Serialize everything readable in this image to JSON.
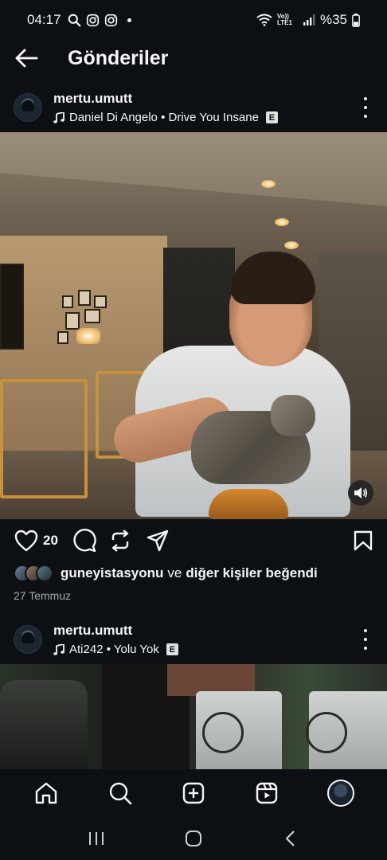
{
  "status_bar": {
    "time": "04:17",
    "network_label": "Vo)) LTE1",
    "battery_text": "%35"
  },
  "header": {
    "title": "Gönderiler"
  },
  "posts": [
    {
      "username": "mertu.umutt",
      "music": "Daniel Di Angelo • Drive You Insane",
      "explicit_badge": "E",
      "like_count": "20",
      "liked_by_user": "guneyistasyonu",
      "liked_by_connector": "ve",
      "liked_by_others": "diğer kişiler beğendi",
      "date": "27 Temmuz"
    },
    {
      "username": "mertu.umutt",
      "music": "Ati242 • Yolu Yok",
      "explicit_badge": "E"
    }
  ],
  "bottom_nav": {
    "items": [
      "home-icon",
      "search-icon",
      "create-icon",
      "reels-icon",
      "profile-avatar"
    ]
  },
  "system_nav": {
    "items": [
      "recents-icon",
      "home-circle-icon",
      "back-chevron-icon"
    ]
  },
  "colors": {
    "background": "#0c1014",
    "text": "#f5f5f5",
    "secondary_text": "#a8a8a8"
  }
}
